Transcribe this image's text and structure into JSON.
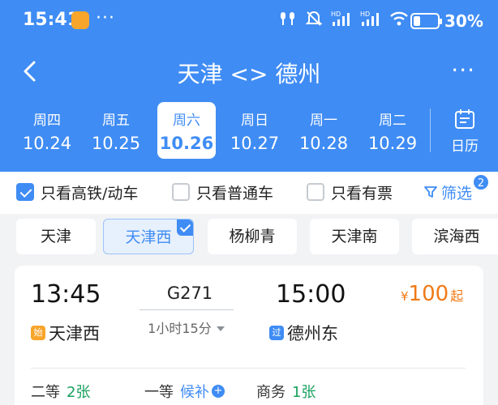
{
  "status_bar": {
    "time": "15:41",
    "more_dots": "···",
    "battery_percent": "30%",
    "battery_level": 30
  },
  "nav": {
    "title": "天津 <> 德州",
    "more_dots": "···"
  },
  "date_tabs": [
    {
      "weekday": "周四",
      "date": "10.24"
    },
    {
      "weekday": "周五",
      "date": "10.25"
    },
    {
      "weekday": "周六",
      "date": "10.26"
    },
    {
      "weekday": "周日",
      "date": "10.27"
    },
    {
      "weekday": "周一",
      "date": "10.28"
    },
    {
      "weekday": "周二",
      "date": "10.29"
    }
  ],
  "selected_date_index": 2,
  "calendar_label": "日历",
  "filters": {
    "high_speed": {
      "label": "只看高铁/动车",
      "checked": true
    },
    "regular": {
      "label": "只看普通车",
      "checked": false
    },
    "available": {
      "label": "只看有票",
      "checked": false
    },
    "screen_label": "筛选",
    "screen_badge": "2"
  },
  "stations": [
    "天津",
    "天津西",
    "杨柳青",
    "天津南",
    "滨海西"
  ],
  "selected_station_index": 1,
  "train": {
    "departure_time": "13:45",
    "arrival_time": "15:00",
    "number": "G271",
    "duration": "1小时15分",
    "departure_tag": "始",
    "departure_station": "天津西",
    "arrival_tag": "过",
    "arrival_station": "德州东",
    "price_currency": "¥",
    "price_amount": "100",
    "price_suffix": "起",
    "seats": [
      {
        "class": "二等",
        "count": "2张"
      },
      {
        "class": "一等",
        "count": "候补"
      },
      {
        "class": "商务",
        "count": "1张"
      }
    ]
  },
  "colors": {
    "accent": "#3f8cf4",
    "price": "#f07a17",
    "available": "#19a15f"
  }
}
